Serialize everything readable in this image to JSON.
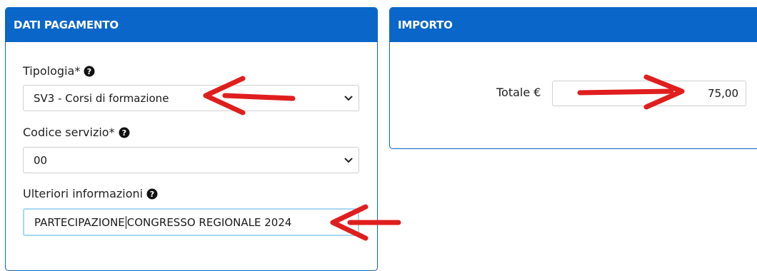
{
  "payment_panel": {
    "title": "DATI PAGAMENTO",
    "tipologia": {
      "label": "Tipologia*",
      "selected": "SV3 - Corsi di formazione"
    },
    "codice_servizio": {
      "label": "Codice servizio*",
      "selected": "00"
    },
    "ulteriori": {
      "label": "Ulteriori informazioni",
      "value_before_caret": "PARTECIPAZIONE",
      "value_after_caret": "CONGRESSO REGIONALE 2024"
    }
  },
  "amount_panel": {
    "title": "IMPORTO",
    "total_label": "Totale €",
    "total_value": "75,00"
  },
  "icons": {
    "help": "question-circle-icon",
    "select": "chevron-down-icon",
    "annotation": "red-arrow-icon"
  },
  "colors": {
    "header": "#0a66c8",
    "arrow": "#e01e1e",
    "focus": "#a6d8f2"
  }
}
